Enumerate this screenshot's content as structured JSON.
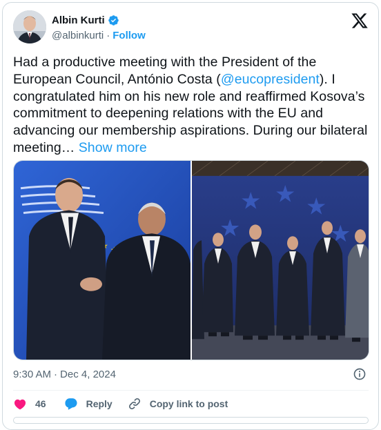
{
  "author": {
    "name": "Albin Kurti",
    "handle": "@albinkurti",
    "separator": "·",
    "follow_label": "Follow"
  },
  "tweet": {
    "text_before": "Had a productive meeting with the President of the European Council, António Costa  (",
    "mention": "@eucopresident",
    "text_after": "). I congratulated him on his new role and reaffirmed Kosova’s commitment to deepening relations with the EU and advancing our membership aspirations. During our bilateral meeting…",
    "show_more": "Show more"
  },
  "meta": {
    "time": "9:30 AM",
    "separator": "·",
    "date": "Dec 4, 2024"
  },
  "actions": {
    "likes": "46",
    "reply_label": "Reply",
    "copy_link_label": "Copy link to post"
  },
  "colors": {
    "accent": "#1d9bf0",
    "like": "#f91880",
    "text": "#0f1419",
    "secondary": "#536471",
    "eu_blue": "#1f4bb0"
  },
  "icons": [
    "verified-badge-icon",
    "x-logo-icon",
    "info-icon",
    "heart-icon",
    "reply-bubble-icon",
    "link-icon"
  ]
}
